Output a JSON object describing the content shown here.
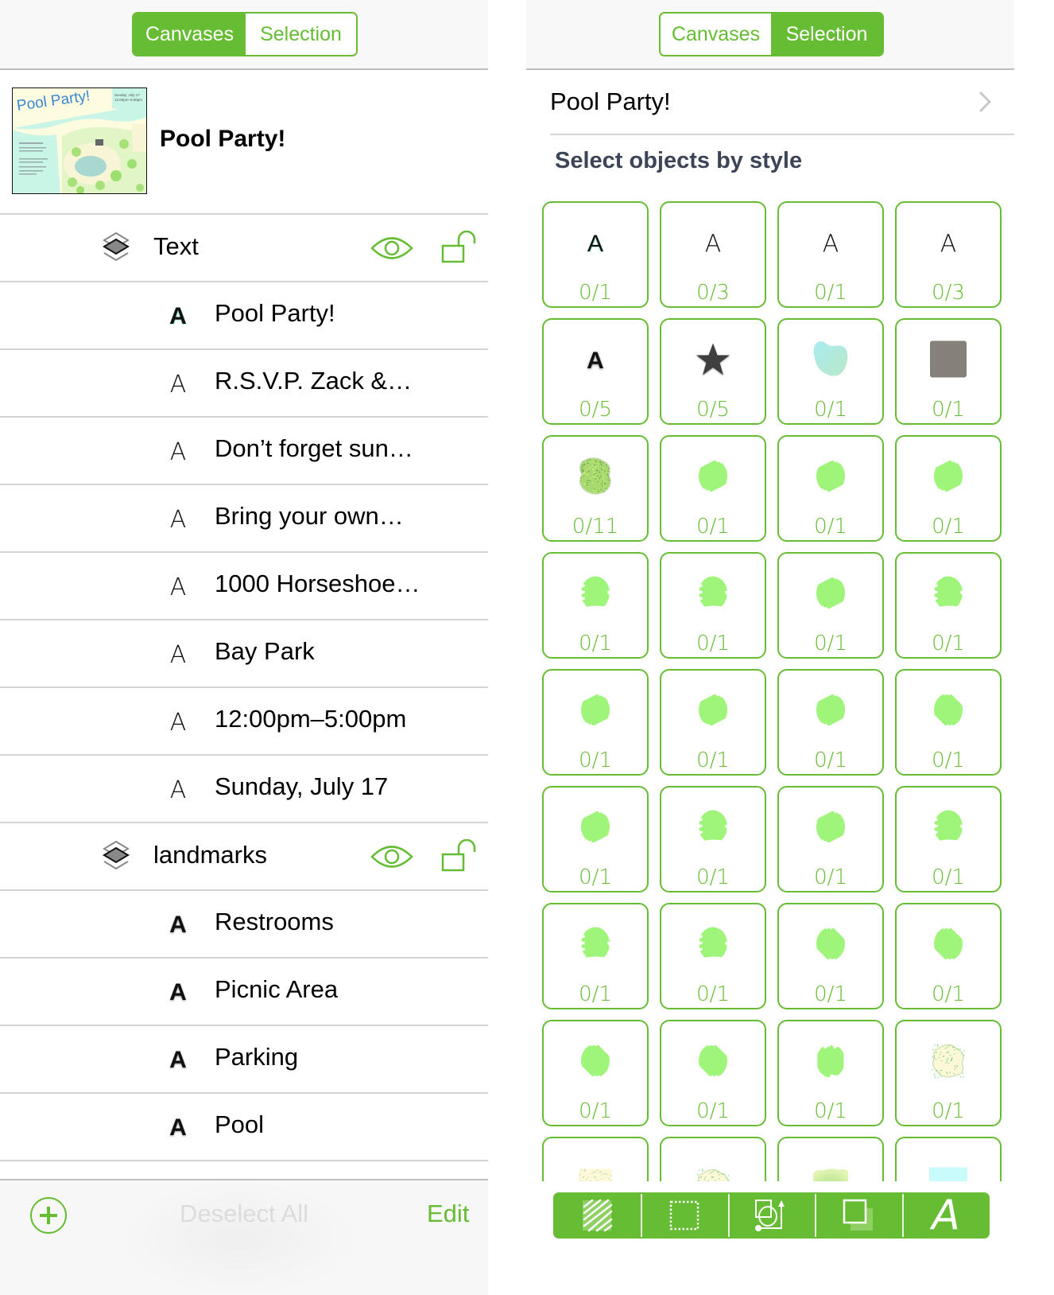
{
  "left_panel": {
    "segmented": {
      "canvases": "Canvases",
      "selection": "Selection",
      "active": "canvases"
    },
    "canvas": {
      "name": "Pool Party!",
      "thumbnail": {
        "title": "Pool Party!",
        "date": "Sunday, July 17",
        "time": "12:00pm–5:00pm"
      }
    },
    "layers": [
      {
        "name": "Text",
        "visible": true,
        "locked": false,
        "items": [
          {
            "glyph": "A",
            "style": "mint",
            "label": "Pool Party!"
          },
          {
            "glyph": "A",
            "style": "thin",
            "label": "R.S.V.P. Zack &…"
          },
          {
            "glyph": "A",
            "style": "thin",
            "label": "Don’t forget sun…"
          },
          {
            "glyph": "A",
            "style": "thin",
            "label": "Bring your own…"
          },
          {
            "glyph": "A",
            "style": "thin",
            "label": "1000 Horseshoe…"
          },
          {
            "glyph": "A",
            "style": "thin",
            "label": "Bay Park"
          },
          {
            "glyph": "A",
            "style": "thin",
            "label": "12:00pm–5:00pm"
          },
          {
            "glyph": "A",
            "style": "thin",
            "label": "Sunday, July 17"
          }
        ]
      },
      {
        "name": "landmarks",
        "visible": true,
        "locked": false,
        "items": [
          {
            "glyph": "A",
            "style": "bold",
            "label": "Restrooms"
          },
          {
            "glyph": "A",
            "style": "bold",
            "label": "Picnic Area"
          },
          {
            "glyph": "A",
            "style": "bold",
            "label": "Parking"
          },
          {
            "glyph": "A",
            "style": "bold",
            "label": "Pool"
          }
        ]
      }
    ],
    "bottom": {
      "add_icon": "plus-circle-icon",
      "deselect_all": "Deselect All",
      "edit": "Edit"
    }
  },
  "right_panel": {
    "segmented": {
      "canvases": "Canvases",
      "selection": "Selection",
      "active": "selection"
    },
    "document_title": "Pool Party!",
    "section_title": "Select objects by style",
    "styles": [
      {
        "preview": "text-mint",
        "glyph": "A",
        "count": "0/1"
      },
      {
        "preview": "text-thin",
        "glyph": "A",
        "count": "0/3"
      },
      {
        "preview": "text-thin",
        "glyph": "A",
        "count": "0/1"
      },
      {
        "preview": "text-thin",
        "glyph": "A",
        "count": "0/3"
      },
      {
        "preview": "text-bold",
        "glyph": "A",
        "count": "0/5"
      },
      {
        "preview": "star",
        "count": "0/5"
      },
      {
        "preview": "pool-blob",
        "count": "0/1"
      },
      {
        "preview": "gray-square",
        "count": "0/1"
      },
      {
        "preview": "bush-stipple",
        "count": "0/11"
      },
      {
        "preview": "scribble-diag",
        "count": "0/1"
      },
      {
        "preview": "scribble-diag",
        "count": "0/1"
      },
      {
        "preview": "scribble-diag",
        "count": "0/1"
      },
      {
        "preview": "scribble-horiz",
        "count": "0/1"
      },
      {
        "preview": "scribble-horiz",
        "count": "0/1"
      },
      {
        "preview": "scribble-diag",
        "count": "0/1"
      },
      {
        "preview": "scribble-horiz",
        "count": "0/1"
      },
      {
        "preview": "scribble-diag",
        "count": "0/1"
      },
      {
        "preview": "scribble-diag",
        "count": "0/1"
      },
      {
        "preview": "scribble-diag",
        "count": "0/1"
      },
      {
        "preview": "scribble-back",
        "count": "0/1"
      },
      {
        "preview": "scribble-diag",
        "count": "0/1"
      },
      {
        "preview": "scribble-horiz",
        "count": "0/1"
      },
      {
        "preview": "scribble-diag",
        "count": "0/1"
      },
      {
        "preview": "scribble-horiz",
        "count": "0/1"
      },
      {
        "preview": "scribble-horiz",
        "count": "0/1"
      },
      {
        "preview": "scribble-horiz",
        "count": "0/1"
      },
      {
        "preview": "scribble-back",
        "count": "0/1"
      },
      {
        "preview": "scribble-back",
        "count": "0/1"
      },
      {
        "preview": "scribble-back",
        "count": "0/1"
      },
      {
        "preview": "scribble-back",
        "count": "0/1"
      },
      {
        "preview": "scribble-vert",
        "count": "0/1"
      },
      {
        "preview": "sand-blob",
        "count": "0/1"
      },
      {
        "preview": "sand-square",
        "count": ""
      },
      {
        "preview": "sand-blob",
        "count": ""
      },
      {
        "preview": "grass-gradient",
        "count": ""
      },
      {
        "preview": "water-square",
        "count": ""
      }
    ],
    "toolbar": [
      {
        "icon": "fill-icon",
        "label": "Fill"
      },
      {
        "icon": "stroke-icon",
        "label": "Stroke"
      },
      {
        "icon": "geometry-icon",
        "label": "Geometry"
      },
      {
        "icon": "shadow-icon",
        "label": "Shadow"
      },
      {
        "icon": "text-style-icon",
        "label": "A"
      }
    ]
  },
  "colors": {
    "accent": "#66bd34",
    "scribble": "#9ef57a",
    "section_title": "#3d4457",
    "disabled": "#dcdcdc"
  }
}
